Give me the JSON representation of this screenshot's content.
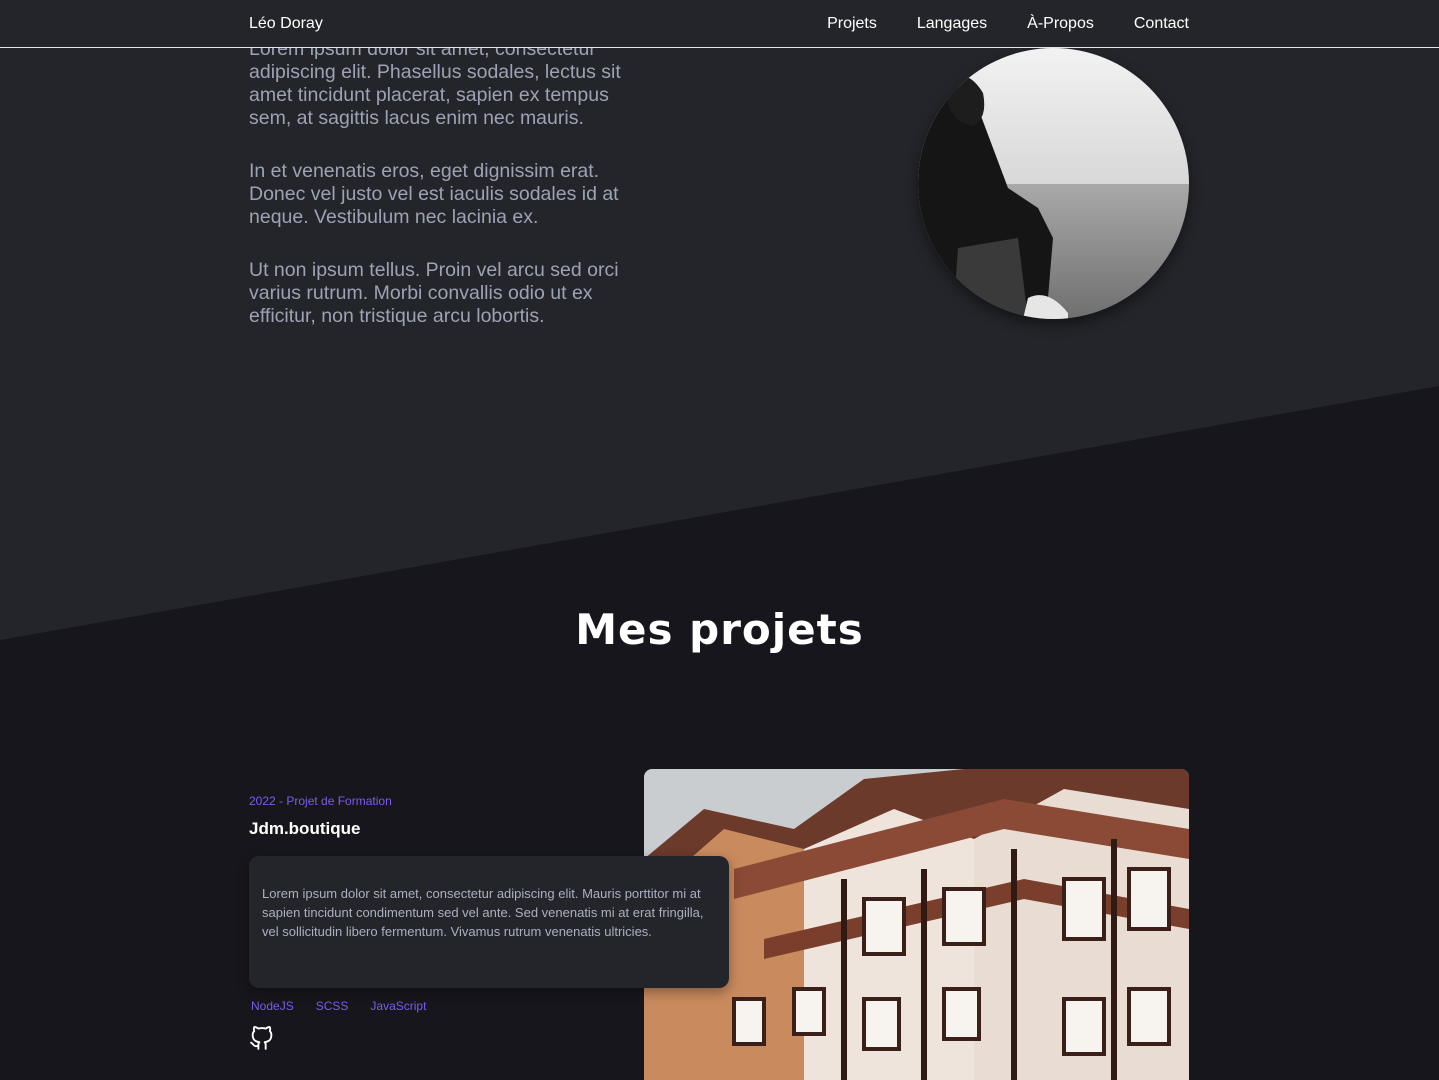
{
  "header": {
    "brand": "Léo Doray",
    "nav": [
      "Projets",
      "Langages",
      "À-Propos",
      "Contact"
    ]
  },
  "about": {
    "paragraphs": [
      "Lorem ipsum dolor sit amet, consectetur adipiscing elit. Phasellus sodales, lectus sit amet tincidunt placerat, sapien ex tempus sem, at sagittis lacus enim nec mauris.",
      "In et venenatis eros, eget dignissim erat. Donec vel justo vel est iaculis sodales id at neque. Vestibulum nec lacinia ex.",
      "Ut non ipsum tellus. Proin vel arcu sed orci varius rutrum. Morbi convallis odio ut ex efficitur, non tristique arcu lobortis."
    ]
  },
  "projects_section": {
    "title": "Mes projets",
    "project": {
      "meta": "2022 - Projet de Formation",
      "name": "Jdm.boutique",
      "description": "Lorem ipsum dolor sit amet, consectetur adipiscing elit. Mauris porttitor mi at sapien tincidunt condimentum sed vel ante. Sed venenatis mi at erat fringilla, vel sollicitudin libero fermentum. Vivamus rutrum venenatis ultricies.",
      "tags": [
        "NodeJS",
        "SCSS",
        "JavaScript"
      ],
      "link_icon": "github-icon"
    }
  },
  "colors": {
    "accent": "#7c5cf0",
    "background_top": "#24252a",
    "background_bottom": "#17161c"
  }
}
